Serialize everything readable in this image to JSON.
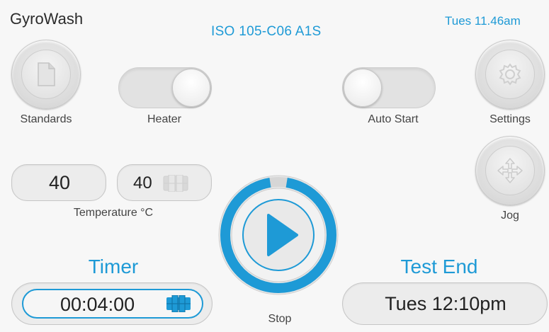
{
  "header": {
    "app_title": "GyroWash",
    "standard": "ISO  105-C06  A1S",
    "clock": "Tues  11.46am"
  },
  "buttons": {
    "standards_label": "Standards",
    "settings_label": "Settings",
    "jog_label": "Jog",
    "stop_label": "Stop"
  },
  "toggles": {
    "heater": {
      "label": "Heater",
      "state": "on"
    },
    "auto_start": {
      "label": "Auto Start",
      "state": "off"
    }
  },
  "temperature": {
    "actual": "40",
    "setpoint": "40",
    "label": "Temperature °C"
  },
  "timer": {
    "heading": "Timer",
    "value": "00:04:00"
  },
  "test_end": {
    "heading": "Test End",
    "value": "Tues  12:10pm"
  },
  "icons": {
    "standards": "document-icon",
    "settings": "gear-icon",
    "jog": "move-arrows-icon",
    "start": "play-icon",
    "keypad": "keypad-icon"
  },
  "colors": {
    "accent": "#1e9ad6",
    "background": "#f7f7f7",
    "control_gray": "#e2e2e2"
  },
  "progress": {
    "ring_fraction": 0.95
  }
}
